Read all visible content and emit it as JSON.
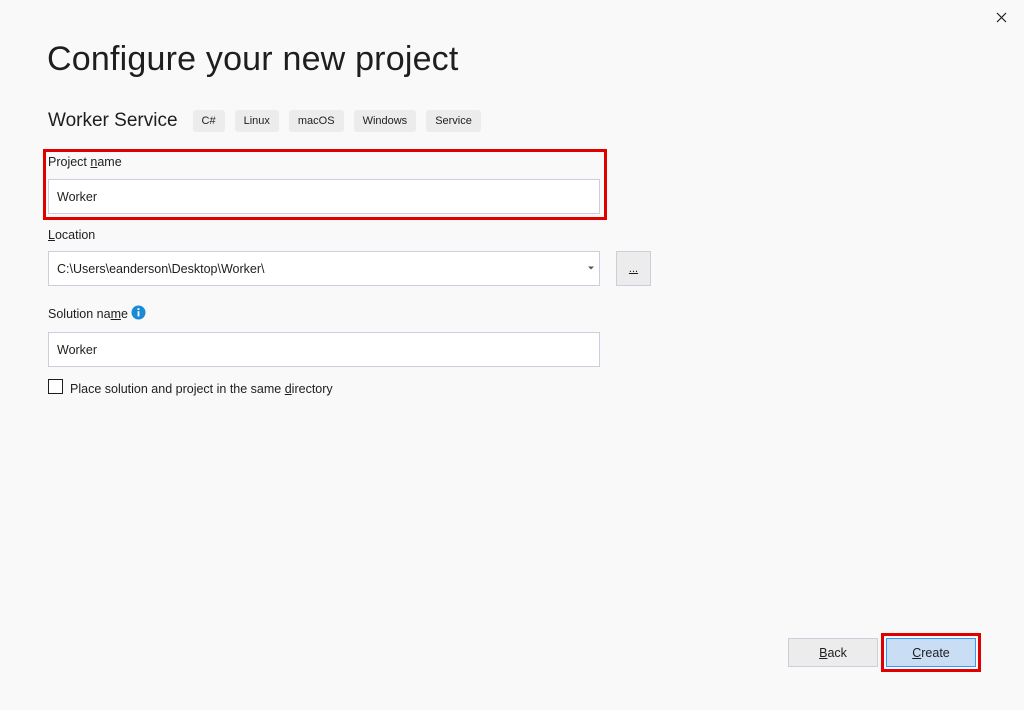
{
  "dialog": {
    "title": "Configure your new project",
    "close_icon": "close-icon"
  },
  "template": {
    "name": "Worker Service",
    "tags": [
      "C#",
      "Linux",
      "macOS",
      "Windows",
      "Service"
    ]
  },
  "project_name": {
    "label_pre": "Project ",
    "label_access": "n",
    "label_post": "ame",
    "value": "Worker"
  },
  "location": {
    "label_access": "L",
    "label_post": "ocation",
    "value": "C:\\Users\\eanderson\\Desktop\\Worker\\",
    "browse_label": "...",
    "dropdown_icon": "chevron-down-icon"
  },
  "solution_name": {
    "label_pre": "Solution na",
    "label_access": "m",
    "label_post": "e",
    "value": "Worker",
    "info_icon": "info-icon"
  },
  "same_directory": {
    "label_pre": "Place solution and project in the same ",
    "label_access": "d",
    "label_post": "irectory",
    "checked": false
  },
  "buttons": {
    "back_access": "B",
    "back_post": "ack",
    "create_access": "C",
    "create_post": "reate"
  },
  "colors": {
    "highlight": "#e10000",
    "info": "#1a8ad4",
    "primary_button": "#c9def5"
  }
}
